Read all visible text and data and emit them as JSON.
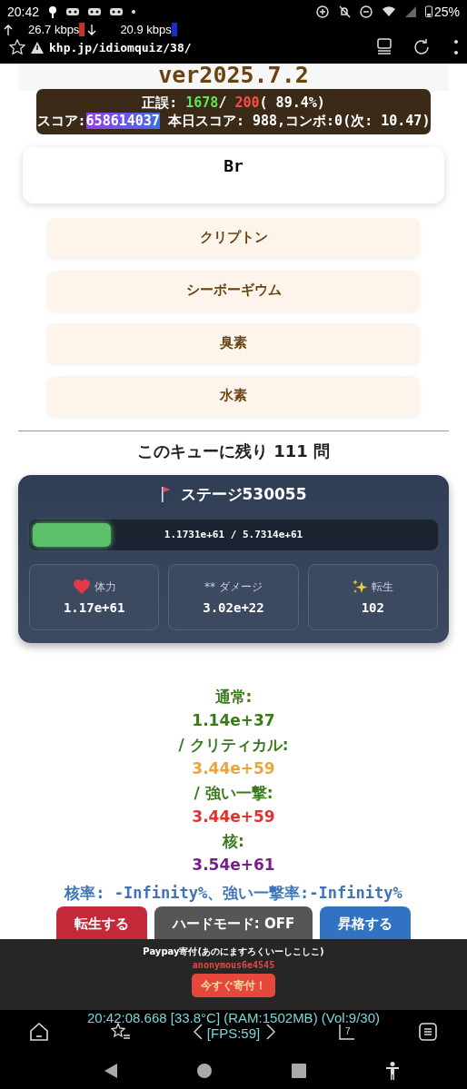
{
  "status_bar": {
    "time": "20:42",
    "battery": "25%"
  },
  "net_speed": {
    "up": "26.7 kbps",
    "down": "20.9 kbps"
  },
  "browser": {
    "url": "khp.jp/idiomquiz/38/"
  },
  "version": "ver2025.7.2",
  "score_box": {
    "label": "正誤:",
    "correct": "1678",
    "separator": "/",
    "wrong": "200",
    "rate": "( 89.4%)",
    "score_label": "スコア:",
    "score": "658614037",
    "today": "本日スコア: 988,コンボ:0(次: 10.47)"
  },
  "question": "Br",
  "choices": [
    "クリプトン",
    "シーボーギウム",
    "臭素",
    "水素"
  ],
  "remaining": "このキューに残り 111 問",
  "stage": {
    "title": "ステージ530055",
    "level": 0.2,
    "hp_text": "1.1731e+61 / 5.7314e+61",
    "stats": [
      {
        "kind": "heart",
        "label": "体力",
        "value": "1.17e+61"
      },
      {
        "kind": "plain",
        "label": "** ダメージ",
        "value": "3.02e+22"
      },
      {
        "kind": "sparkle",
        "label": "転生",
        "value": "102"
      }
    ]
  },
  "damage": [
    {
      "text": "通常:",
      "color": "#3b7a1c"
    },
    {
      "text": "1.14e+37",
      "color": "#3b7a1c"
    },
    {
      "text": "/ クリティカル:",
      "color": "#3b7a1c"
    },
    {
      "text": "3.44e+59",
      "color": "#eba53a"
    },
    {
      "text": "/ 強い一撃:",
      "color": "#3b7a1c"
    },
    {
      "text": "3.44e+59",
      "color": "#e0332e"
    },
    {
      "text": "核:",
      "color": "#3b7a1c"
    },
    {
      "text": "3.54e+61",
      "color": "#76208a"
    }
  ],
  "rates": "核率: -Infinity%、強い一撃率:-Infinity%",
  "actions": [
    {
      "label": "転生する",
      "color": "#c4293a"
    },
    {
      "label": "ハードモード: OFF",
      "color": "#565656"
    },
    {
      "label": "昇格する",
      "color": "#3173c2"
    }
  ],
  "ad": {
    "title": "Paypay寄付(あのにますろくいーしこしこ)",
    "user": "anonymous6e4545",
    "button": "今すぐ寄付！"
  },
  "overlay": {
    "line1": "20:42:08.668 [33.8°C] (RAM:1502MB) (Vol:9/30)",
    "line2": "[FPS:59]",
    "tabs": "7"
  }
}
